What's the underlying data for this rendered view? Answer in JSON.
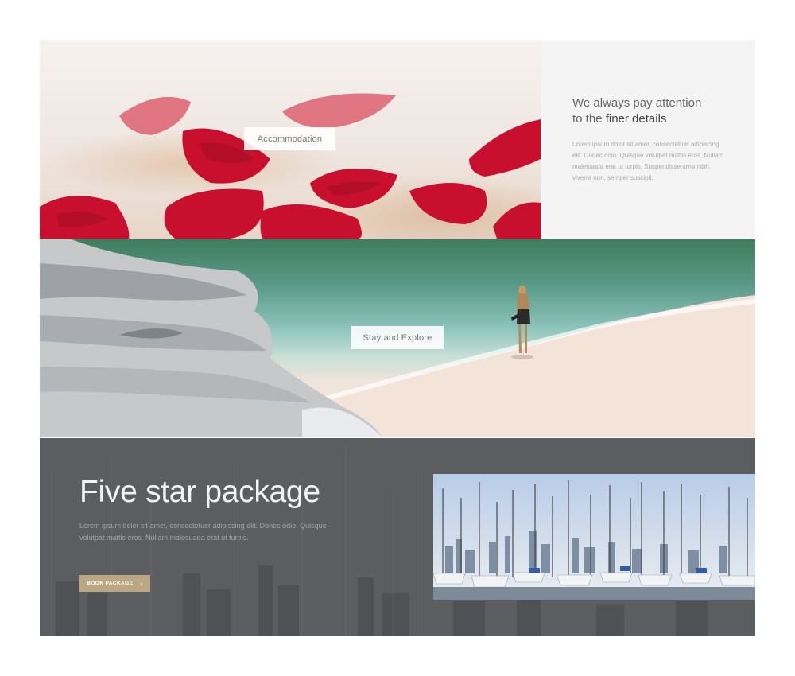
{
  "tiles": {
    "accommodation": {
      "label": "Accommodation"
    },
    "stay_explore": {
      "label": "Stay and Explore"
    }
  },
  "details": {
    "heading_line1": "We always pay attention",
    "heading_line2_prefix": "to the ",
    "heading_line2_strong": "finer details",
    "body": "Lorem ipsum dolor sit amet, consectetuer adipiscing elit. Donec odio. Quisque volutpat mattis eros. Nullam malesuada erat ut turpis. Suspendisse urna nibh, viverra non, semper suscipit."
  },
  "package": {
    "title": "Five star package",
    "body": "Lorem ipsum dolor sit amet, consectetuer adipiscing elit. Donec odio. Quisque volutpat mattis eros. Nullam malesuada erat ut turpis.",
    "button_label": "BOOK PACKAGE",
    "button_icon": "chevron-right-icon"
  },
  "colors": {
    "details_bg": "#f4f4f4",
    "package_bg": "#5c5d61",
    "button_bg": "#bca783",
    "petal_red": "#c8102e"
  }
}
